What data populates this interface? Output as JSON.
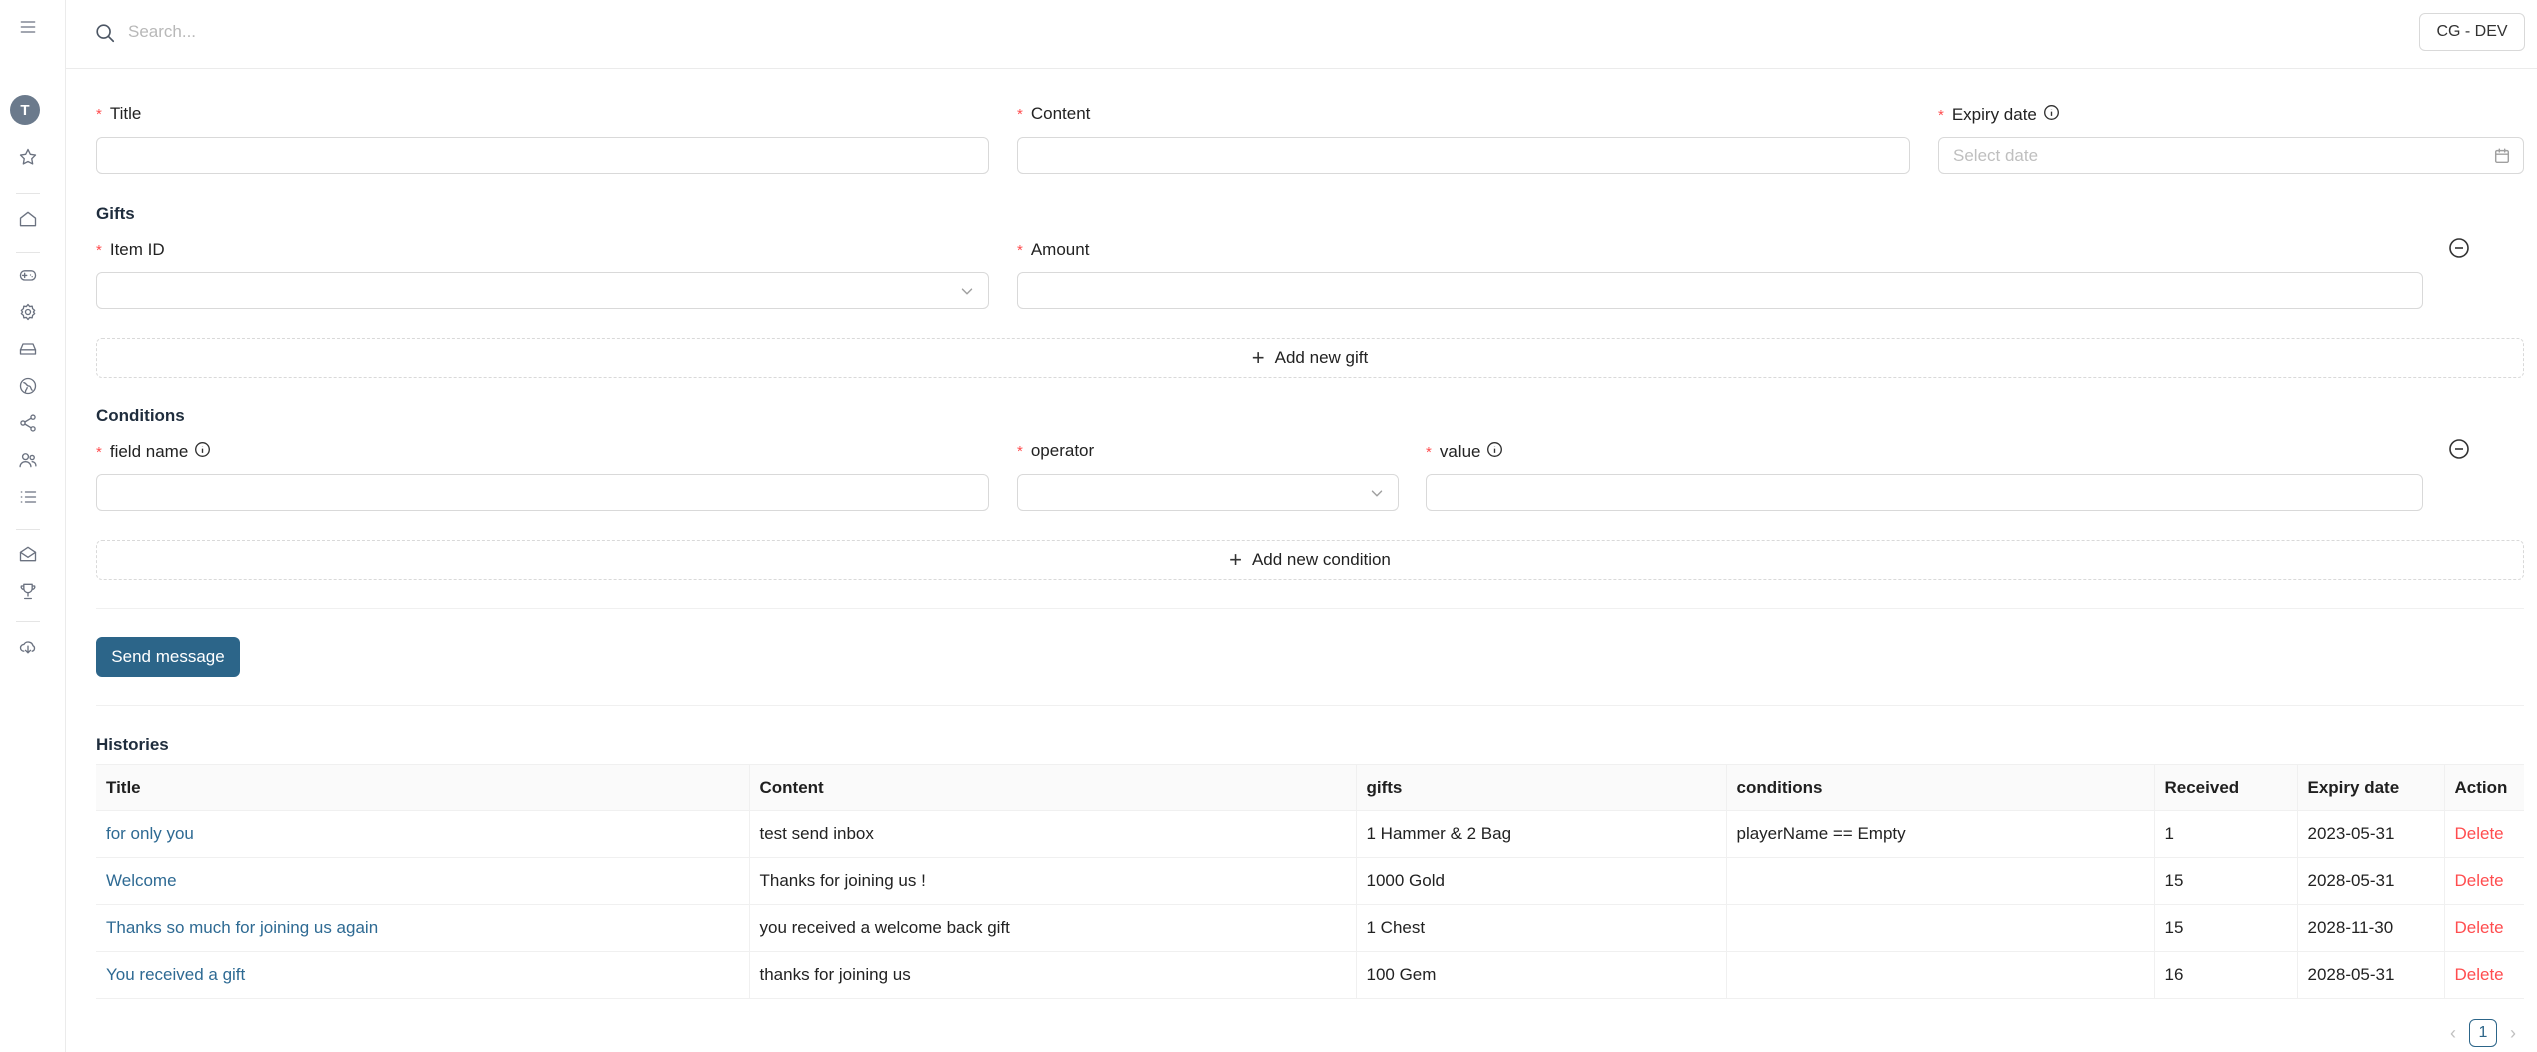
{
  "nav": {
    "avatar_letter": "T",
    "icons": [
      "menu-icon",
      "star-icon",
      "home-icon",
      "gamepad-icon",
      "settings-icon",
      "inbox-tray-icon",
      "globe-icon",
      "share-icon",
      "users-icon",
      "list-icon",
      "mail-icon",
      "trophy-icon",
      "cloud-download-icon"
    ]
  },
  "topbar": {
    "search_placeholder": "Search...",
    "env_label": "CG - DEV"
  },
  "form": {
    "title_label": "Title",
    "content_label": "Content",
    "expiry_label": "Expiry date",
    "expiry_placeholder": "Select date",
    "gifts_title": "Gifts",
    "item_id_label": "Item ID",
    "amount_label": "Amount",
    "add_gift_label": "Add new gift",
    "conditions_title": "Conditions",
    "field_name_label": "field name",
    "operator_label": "operator",
    "value_label": "value",
    "add_condition_label": "Add new condition",
    "send_label": "Send message",
    "required_mark": "*"
  },
  "histories": {
    "title": "Histories",
    "columns": [
      "Title",
      "Content",
      "gifts",
      "conditions",
      "Received",
      "Expiry date",
      "Action"
    ],
    "rows": [
      {
        "title": "for only you",
        "content": "test send inbox",
        "gifts": "1 Hammer & 2 Bag",
        "conditions": "playerName == Empty",
        "received": "1",
        "expiry": "2023-05-31",
        "action": "Delete"
      },
      {
        "title": "Welcome",
        "content": "Thanks for joining us !",
        "gifts": "1000 Gold",
        "conditions": "",
        "received": "15",
        "expiry": "2028-05-31",
        "action": "Delete"
      },
      {
        "title": "Thanks so much for joining us again",
        "content": "you received a welcome back gift",
        "gifts": "1 Chest",
        "conditions": "",
        "received": "15",
        "expiry": "2028-11-30",
        "action": "Delete"
      },
      {
        "title": "You received a gift",
        "content": "thanks for joining us",
        "gifts": "100 Gem",
        "conditions": "",
        "received": "16",
        "expiry": "2028-05-31",
        "action": "Delete"
      }
    ]
  },
  "pagination": {
    "current": "1",
    "prev": "‹",
    "next": "›"
  },
  "colors": {
    "primary": "#2c6589",
    "link": "#2e6a93",
    "danger": "#ff4d4f",
    "required": "#ff4d4f"
  }
}
